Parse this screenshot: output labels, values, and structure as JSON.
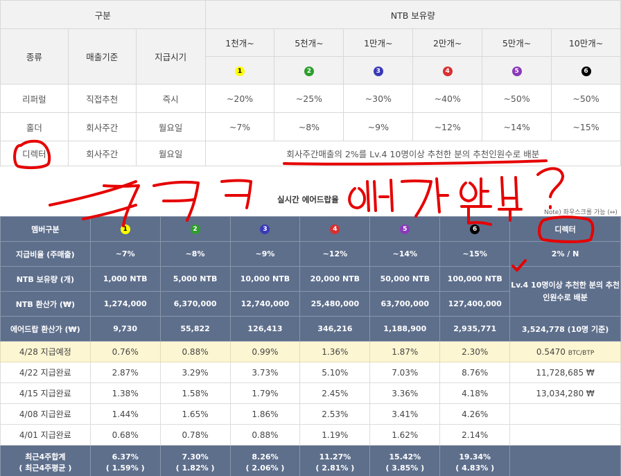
{
  "top_table": {
    "header": {
      "gubun": "구분",
      "holding": "NTB 보유량",
      "type": "종류",
      "sales_basis": "매출기준",
      "pay_time": "지급시기"
    },
    "tiers": [
      {
        "label": "1천개~",
        "num": "1",
        "color": "#ffff00",
        "text_color": "#000000"
      },
      {
        "label": "5천개~",
        "num": "2",
        "color": "#2e9e2e",
        "text_color": "#ffffff"
      },
      {
        "label": "1만개~",
        "num": "3",
        "color": "#3a3ab8",
        "text_color": "#ffffff"
      },
      {
        "label": "2만개~",
        "num": "4",
        "color": "#d93030",
        "text_color": "#ffffff"
      },
      {
        "label": "5만개~",
        "num": "5",
        "color": "#8a3ab8",
        "text_color": "#ffffff"
      },
      {
        "label": "10만개~",
        "num": "6",
        "color": "#000000",
        "text_color": "#ffffff"
      }
    ],
    "rows": [
      {
        "type": "리퍼럴",
        "basis": "직접추천",
        "time": "즉시",
        "values": [
          "~20%",
          "~25%",
          "~30%",
          "~40%",
          "~50%",
          "~50%"
        ]
      },
      {
        "type": "홀더",
        "basis": "회사주간",
        "time": "월요일",
        "values": [
          "~7%",
          "~8%",
          "~9%",
          "~12%",
          "~14%",
          "~15%"
        ]
      },
      {
        "type": "디렉터",
        "basis": "회사주간",
        "time": "월요일",
        "note": "회사주간매출의 2%를 Lv.4 10명이상 추천한 분의 추천인원수로 배분"
      }
    ]
  },
  "middle": {
    "title": "실시간 에어드랍율",
    "note": "Note) 좌우스크롤 가능 (↔)"
  },
  "bottom_table": {
    "member_header": "멤버구분",
    "tier_nums": [
      "1",
      "2",
      "3",
      "4",
      "5",
      "6"
    ],
    "director_label": "디렉터",
    "rows": [
      {
        "label": "지급비율 (주매출)",
        "values": [
          "~7%",
          "~8%",
          "~9%",
          "~12%",
          "~14%",
          "~15%"
        ],
        "director": "2% / N"
      },
      {
        "label": "NTB 보유량 (개)",
        "values": [
          "1,000 NTB",
          "5,000 NTB",
          "10,000 NTB",
          "20,000 NTB",
          "50,000 NTB",
          "100,000 NTB"
        ]
      },
      {
        "label": "NTB 환산가 (₩)",
        "values": [
          "1,274,000",
          "6,370,000",
          "12,740,000",
          "25,480,000",
          "63,700,000",
          "127,400,000"
        ]
      },
      {
        "label": "에어드랍 환산가 (₩)",
        "values": [
          "9,730",
          "55,822",
          "126,413",
          "346,216",
          "1,188,900",
          "2,935,771"
        ],
        "director": "3,524,778 (10명 기준)"
      }
    ],
    "director_merged": "Lv.4 10명이상 추천한 분의 추천인원수로 배분",
    "weekly": [
      {
        "label": "4/28 지급예정",
        "values": [
          "0.76%",
          "0.88%",
          "0.99%",
          "1.36%",
          "1.87%",
          "2.30%"
        ],
        "director": "0.5470",
        "director_unit": "BTC/BTP"
      },
      {
        "label": "4/22 지급완료",
        "values": [
          "2.87%",
          "3.29%",
          "3.73%",
          "5.10%",
          "7.03%",
          "8.76%"
        ],
        "director": "11,728,685 ₩"
      },
      {
        "label": "4/15 지급완료",
        "values": [
          "1.38%",
          "1.58%",
          "1.79%",
          "2.45%",
          "3.36%",
          "4.18%"
        ],
        "director": "13,034,280 ₩"
      },
      {
        "label": "4/08 지급완료",
        "values": [
          "1.44%",
          "1.65%",
          "1.86%",
          "2.53%",
          "3.41%",
          "4.26%"
        ],
        "director": ""
      },
      {
        "label": "4/01 지급완료",
        "values": [
          "0.68%",
          "0.78%",
          "0.88%",
          "1.19%",
          "1.62%",
          "2.14%"
        ],
        "director": ""
      }
    ],
    "summary": {
      "label1": "최근4주합계",
      "label2": "( 최근4주평균 )",
      "totals": [
        "6.37%",
        "7.30%",
        "8.26%",
        "11.27%",
        "15.42%",
        "19.34%"
      ],
      "averages": [
        "( 1.59% )",
        "( 1.82% )",
        "( 2.06% )",
        "( 2.81% )",
        "( 3.85% )",
        "( 4.83% )"
      ]
    }
  },
  "annotation": {
    "color": "#e60000"
  }
}
